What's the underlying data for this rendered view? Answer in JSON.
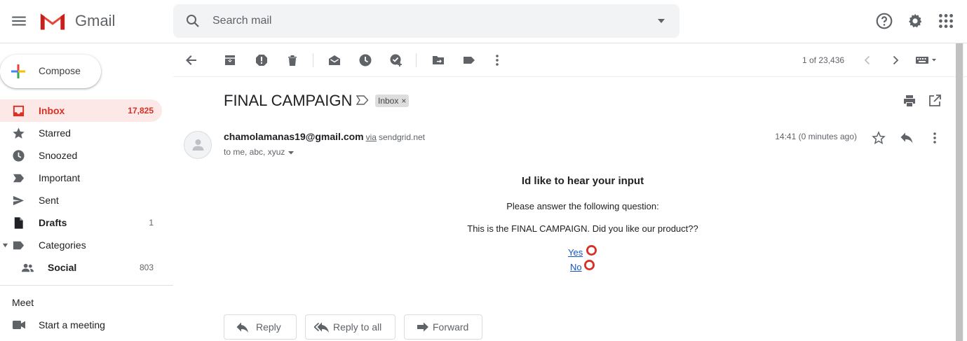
{
  "app": {
    "brand": "Gmail"
  },
  "search": {
    "placeholder": "Search mail"
  },
  "compose": {
    "label": "Compose"
  },
  "sidebar": {
    "items": [
      {
        "label": "Inbox",
        "count": "17,825",
        "icon": "inbox-icon"
      },
      {
        "label": "Starred",
        "count": "",
        "icon": "star-icon"
      },
      {
        "label": "Snoozed",
        "count": "",
        "icon": "clock-icon"
      },
      {
        "label": "Important",
        "count": "",
        "icon": "important-icon"
      },
      {
        "label": "Sent",
        "count": "",
        "icon": "send-icon"
      },
      {
        "label": "Drafts",
        "count": "1",
        "icon": "draft-icon"
      },
      {
        "label": "Categories",
        "count": "",
        "icon": "label-icon"
      },
      {
        "label": "Social",
        "count": "803",
        "icon": "people-icon"
      }
    ],
    "meet_title": "Meet",
    "meet_item": "Start a meeting"
  },
  "toolbar": {
    "pager": "1 of 23,436"
  },
  "email": {
    "subject": "FINAL CAMPAIGN",
    "label_chip": "Inbox",
    "chip_close": "×",
    "sender": "chamolamanas19@gmail.com",
    "via": "via",
    "via_domain": "sendgrid.net",
    "recipients": "to me, abc, xyuz",
    "time": "14:41 (0 minutes ago)",
    "body": {
      "heading": "Id like to hear your input",
      "line1": "Please answer the following question:",
      "line2": "This is the FINAL CAMPAIGN. Did you like our product??",
      "options": [
        "Yes",
        "No"
      ]
    }
  },
  "actions": {
    "reply": "Reply",
    "reply_all": "Reply to all",
    "forward": "Forward"
  },
  "colors": {
    "accent_red": "#d93025",
    "active_bg": "#fce8e6",
    "link": "#1155cc",
    "badge": "#d93025"
  }
}
